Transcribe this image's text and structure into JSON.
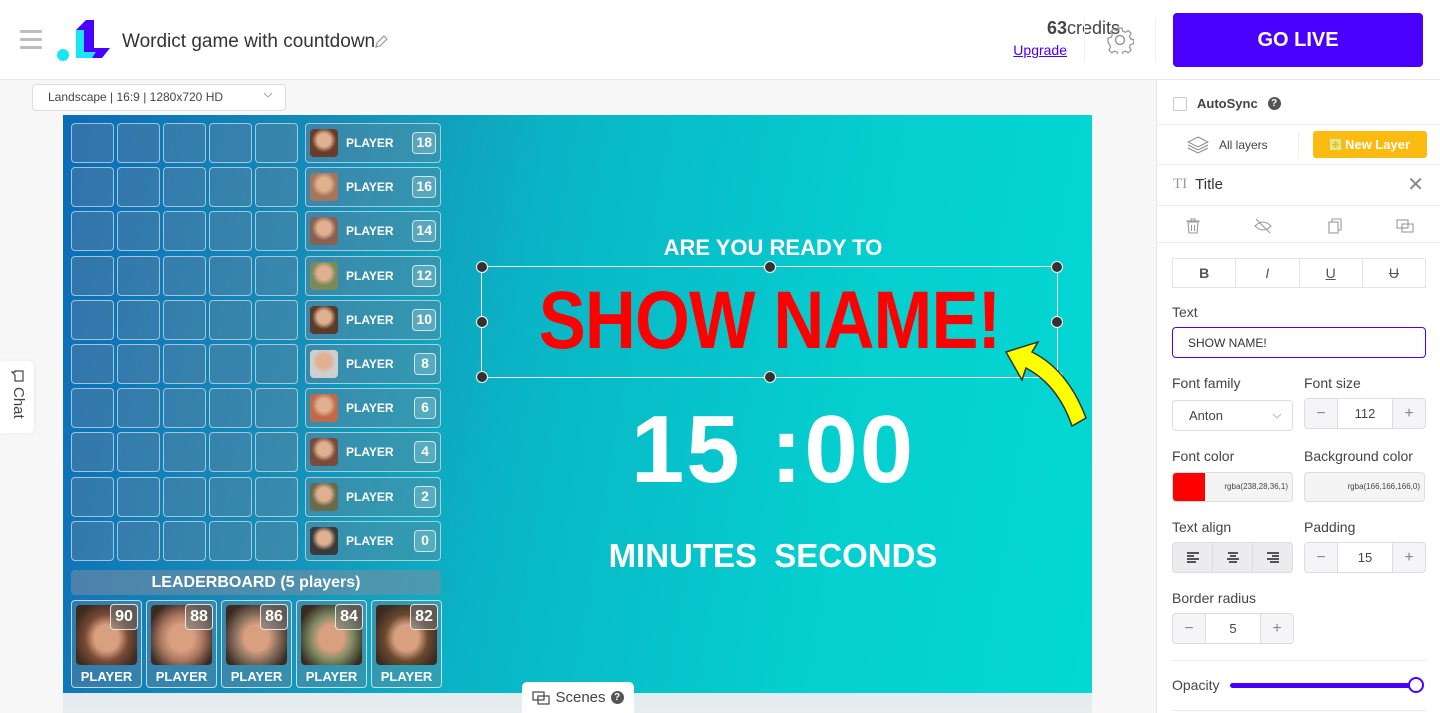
{
  "header": {
    "app_title": "Wordict game with countdown",
    "credits_count": "63",
    "credits_label": "credits",
    "upgrade_label": "Upgrade",
    "go_live_label": "GO LIVE"
  },
  "canvas_toolbar": {
    "resolution_select": "Landscape | 16:9 | 1280x720 HD"
  },
  "chat_tab": {
    "label": "Chat"
  },
  "scenes_tab": {
    "label": "Scenes",
    "help": "?"
  },
  "stage": {
    "player_list": [
      {
        "name": "PLAYER",
        "score": "18",
        "avatar_color": "#6b3b2a"
      },
      {
        "name": "PLAYER",
        "score": "16",
        "avatar_color": "#a8755a"
      },
      {
        "name": "PLAYER",
        "score": "14",
        "avatar_color": "#8a6050"
      },
      {
        "name": "PLAYER",
        "score": "12",
        "avatar_color": "#7a8a5a"
      },
      {
        "name": "PLAYER",
        "score": "10",
        "avatar_color": "#5a3a2a"
      },
      {
        "name": "PLAYER",
        "score": "8",
        "avatar_color": "#cfcfcf"
      },
      {
        "name": "PLAYER",
        "score": "6",
        "avatar_color": "#c06a4a"
      },
      {
        "name": "PLAYER",
        "score": "4",
        "avatar_color": "#7a4a3a"
      },
      {
        "name": "PLAYER",
        "score": "2",
        "avatar_color": "#6a6a4a"
      },
      {
        "name": "PLAYER",
        "score": "0",
        "avatar_color": "#3a3a3a"
      }
    ],
    "leaderboard_title": "LEADERBOARD (5 players)",
    "leaderboard": [
      {
        "name": "PLAYER",
        "score": "90",
        "photo_color": "#7a4a35"
      },
      {
        "name": "PLAYER",
        "score": "88",
        "photo_color": "#a87560"
      },
      {
        "name": "PLAYER",
        "score": "86",
        "photo_color": "#8a7060"
      },
      {
        "name": "PLAYER",
        "score": "84",
        "photo_color": "#7a8860"
      },
      {
        "name": "PLAYER",
        "score": "82",
        "photo_color": "#6a4a30"
      }
    ],
    "ready_text": "ARE YOU READY TO",
    "show_name": "SHOW NAME!",
    "timer": "15 :00",
    "timer_units": "MINUTES  SECONDS"
  },
  "panel": {
    "autosync_label": "AutoSync",
    "autosync_help": "?",
    "all_layers_label": "All layers",
    "new_layer_label": "New Layer",
    "layer_name": "Title",
    "layer_type_glyph": "TI",
    "format_buttons": [
      "B",
      "I",
      "U",
      "U"
    ],
    "text_label": "Text",
    "text_value": "SHOW NAME!",
    "font_family_label": "Font family",
    "font_family_value": "Anton",
    "font_size_label": "Font size",
    "font_size_value": "112",
    "font_color_label": "Font color",
    "font_color_value": "rgba(238,28,36,1)",
    "font_color_swatch": "#ff0000",
    "bg_color_label": "Background color",
    "bg_color_value": "rgba(166,166,166,0)",
    "text_align_label": "Text align",
    "padding_label": "Padding",
    "padding_value": "15",
    "border_radius_label": "Border radius",
    "border_radius_value": "5",
    "opacity_label": "Opacity",
    "opacity_value": 1.0,
    "minus": "−",
    "plus": "+"
  },
  "colors": {
    "accent": "#4a00ff",
    "new_layer": "#fbbb10",
    "logo_cyan": "#19e6f0",
    "logo_purple": "#4a00ff"
  }
}
